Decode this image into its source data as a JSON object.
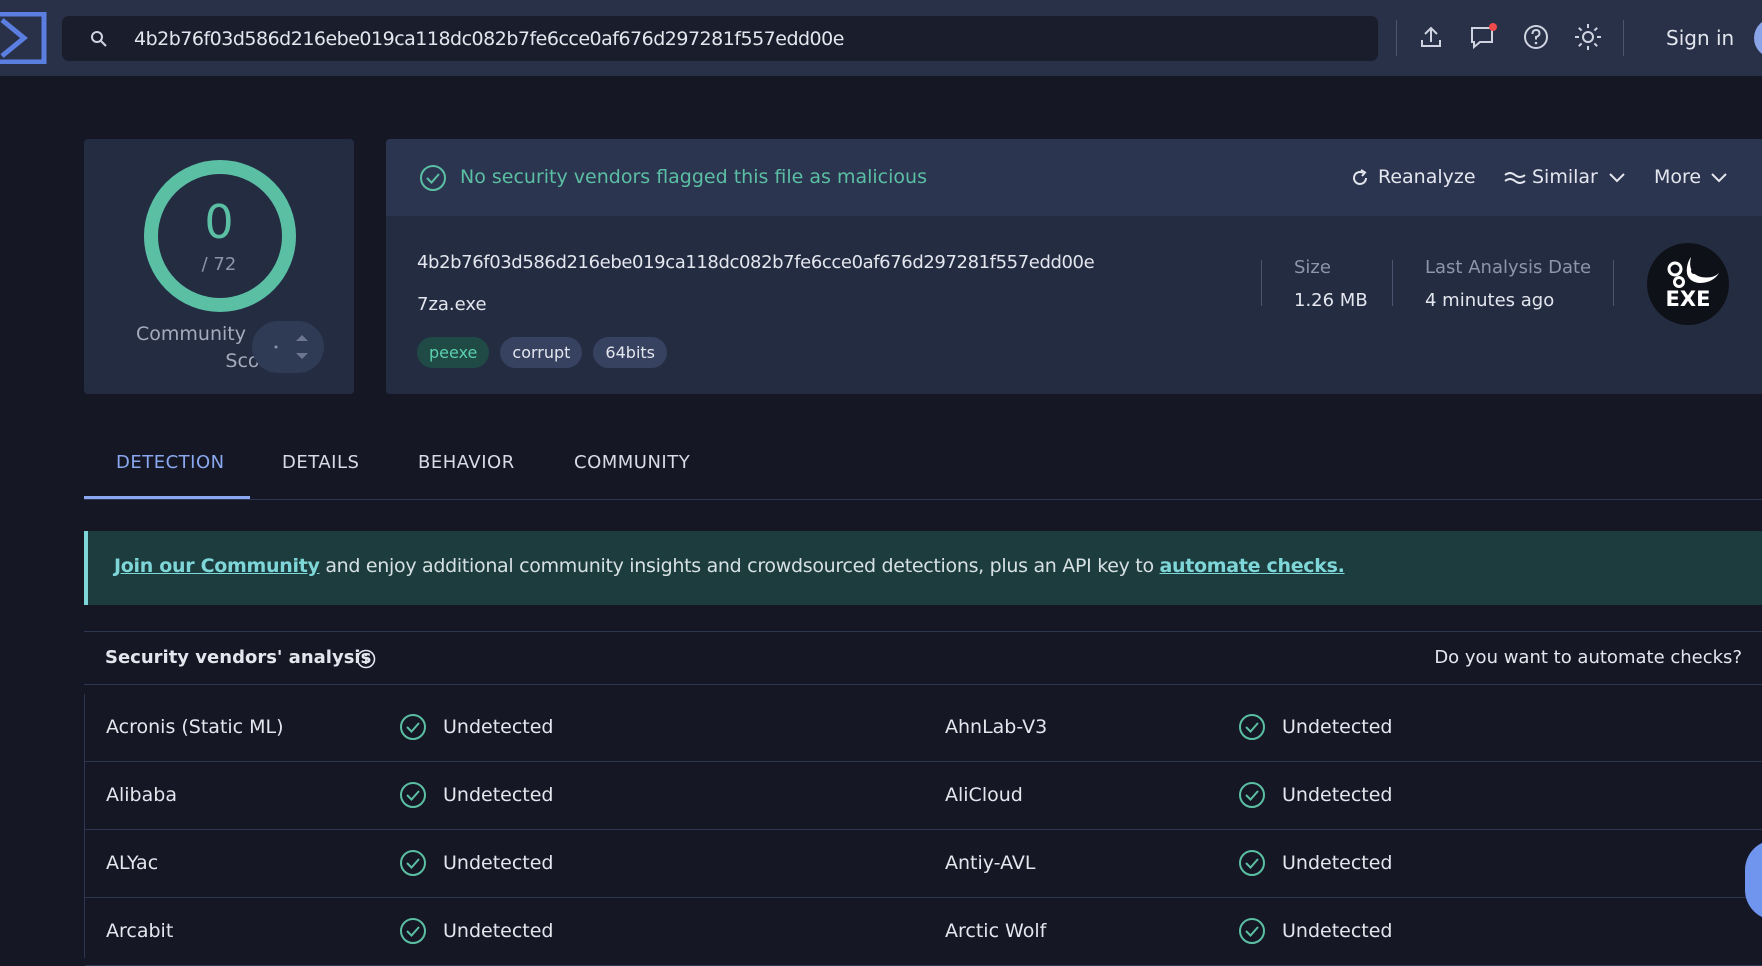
{
  "search": {
    "value": "4b2b76f03d586d216ebe019ca118dc082b7fe6cce0af676d297281f557edd00e"
  },
  "header": {
    "sign_in": "Sign in"
  },
  "score": {
    "detections": "0",
    "total": "/ 72",
    "community_label_1": "Community",
    "community_label_2": "Score"
  },
  "banner": {
    "message": "No security vendors flagged this file as malicious",
    "reanalyze": "Reanalyze",
    "similar": "Similar",
    "more": "More"
  },
  "file": {
    "hash": "4b2b76f03d586d216ebe019ca118dc082b7fe6cce0af676d297281f557edd00e",
    "name": "7za.exe",
    "tags": [
      "peexe",
      "corrupt",
      "64bits"
    ],
    "size_label": "Size",
    "size_value": "1.26 MB",
    "date_label": "Last Analysis Date",
    "date_value": "4 minutes ago",
    "type_badge": "EXE"
  },
  "tabs": [
    {
      "label": "DETECTION",
      "active": true
    },
    {
      "label": "DETAILS",
      "active": false
    },
    {
      "label": "BEHAVIOR",
      "active": false
    },
    {
      "label": "COMMUNITY",
      "active": false
    }
  ],
  "join": {
    "link1": "Join our Community",
    "middle": " and enjoy additional community insights and crowdsourced detections, plus an API key to ",
    "link2": "automate checks."
  },
  "vendors_section": {
    "title": "Security vendors' analysis",
    "automate": "Do you want to automate checks?"
  },
  "vendors": [
    {
      "left_name": "Acronis (Static ML)",
      "left_status": "Undetected",
      "right_name": "AhnLab-V3",
      "right_status": "Undetected"
    },
    {
      "left_name": "Alibaba",
      "left_status": "Undetected",
      "right_name": "AliCloud",
      "right_status": "Undetected"
    },
    {
      "left_name": "ALYac",
      "left_status": "Undetected",
      "right_name": "Antiy-AVL",
      "right_status": "Undetected"
    },
    {
      "left_name": "Arcabit",
      "left_status": "Undetected",
      "right_name": "Arctic Wolf",
      "right_status": "Undetected"
    }
  ],
  "colors": {
    "accent": "#8aa8f0",
    "safe": "#5bbfa3",
    "background": "#151724"
  }
}
